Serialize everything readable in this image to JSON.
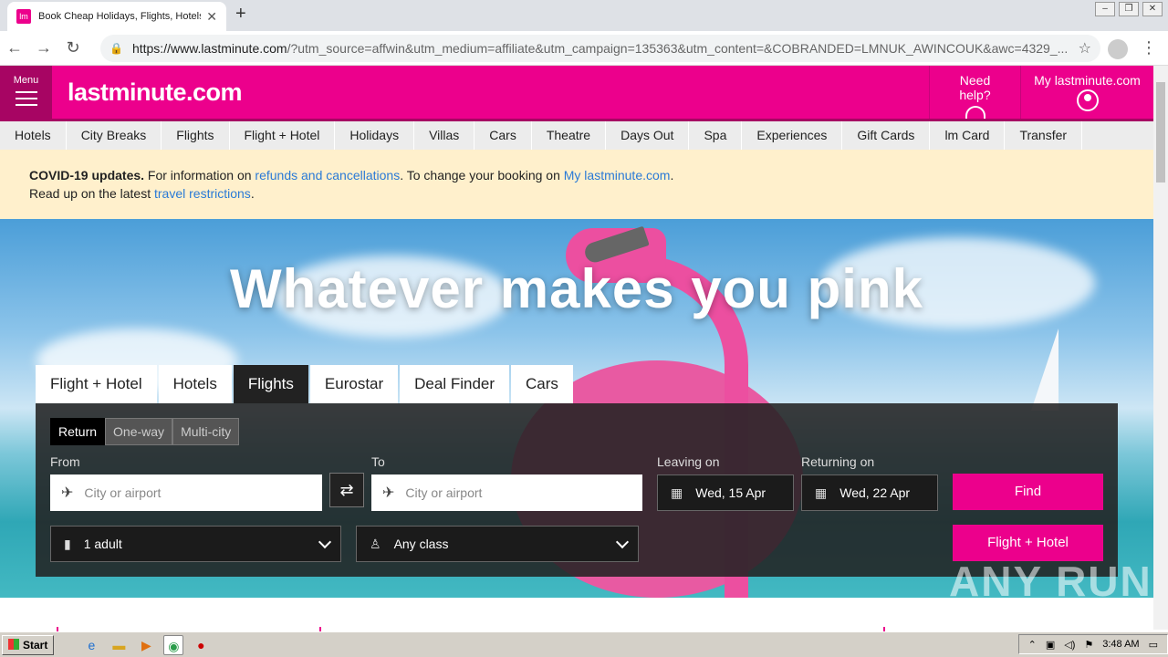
{
  "browser": {
    "tab_title": "Book Cheap Holidays, Flights, Hotels",
    "favicon_text": "lm",
    "url_domain": "https://www.lastminute.com",
    "url_rest": "/?utm_source=affwin&utm_medium=affiliate&utm_campaign=135363&utm_content=&COBRANDED=LMNUK_AWINCOUK&awc=4329_..."
  },
  "header": {
    "menu_label": "Menu",
    "logo": "lastminute.com",
    "help_label": "Need help?",
    "account_label": "My lastminute.com"
  },
  "nav": [
    "Hotels",
    "City Breaks",
    "Flights",
    "Flight + Hotel",
    "Holidays",
    "Villas",
    "Cars",
    "Theatre",
    "Days Out",
    "Spa",
    "Experiences",
    "Gift Cards",
    "lm Card",
    "Transfer"
  ],
  "covid": {
    "title": "COVID-19 updates.",
    "t1": " For information on ",
    "link1": "refunds and cancellations",
    "t2": ". To change your booking on ",
    "link2": "My lastminute.com",
    "t3": ".",
    "t4": "Read up on the latest ",
    "link3": "travel restrictions",
    "t5": "."
  },
  "hero": {
    "title": "Whatever makes you pink"
  },
  "search": {
    "tabs": [
      "Flight + Hotel",
      "Hotels",
      "Flights",
      "Eurostar",
      "Deal Finder",
      "Cars"
    ],
    "active_tab": "Flights",
    "trip_types": [
      "Return",
      "One-way",
      "Multi-city"
    ],
    "from_label": "From",
    "to_label": "To",
    "from_placeholder": "City or airport",
    "to_placeholder": "City or airport",
    "leaving_label": "Leaving on",
    "returning_label": "Returning on",
    "leaving_value": "Wed, 15 Apr",
    "returning_value": "Wed, 22 Apr",
    "passengers": "1 adult",
    "cabin_class": "Any class",
    "find_button": "Find",
    "flight_hotel_button": "Flight + Hotel"
  },
  "watermark": "ANY RUN",
  "taskbar": {
    "start": "Start",
    "clock": "3:48 AM"
  },
  "colors": {
    "brand": "#ec008c",
    "brand_dark": "#a70563",
    "banner": "#fff0cc",
    "link": "#2a7ad6"
  }
}
